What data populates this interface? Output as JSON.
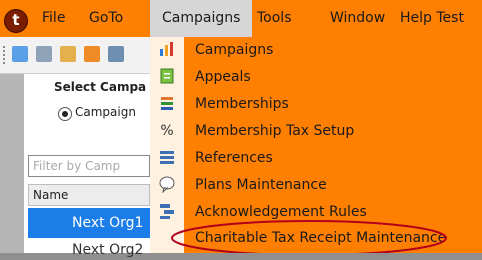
{
  "menubar": {
    "logo_letter": "t",
    "items": [
      {
        "label": "File"
      },
      {
        "label": "GoTo"
      },
      {
        "label": "Campaigns",
        "active": true
      },
      {
        "label": "Tools"
      },
      {
        "label": "Window"
      },
      {
        "label": "Help Test"
      }
    ]
  },
  "toolbar": {
    "icons": [
      "user-icon",
      "document-icon",
      "link-icon",
      "edit-icon",
      "form-icon"
    ]
  },
  "panel": {
    "title": "Select Campa",
    "radio_label": "Campaign",
    "filter_placeholder": "Filter by Camp",
    "column_header": "Name",
    "rows": [
      "Next Org1",
      "Next Org2"
    ]
  },
  "dropdown": {
    "items": [
      {
        "label": "Campaigns",
        "icon": "bar-chart-icon"
      },
      {
        "label": "Appeals",
        "icon": "green-document-icon"
      },
      {
        "label": "Memberships",
        "icon": "stack-icon"
      },
      {
        "label": "Membership Tax Setup",
        "icon": "percent-icon"
      },
      {
        "label": "References",
        "icon": "list-icon"
      },
      {
        "label": "Plans Maintenance",
        "icon": "speech-bubble-icon"
      },
      {
        "label": "Acknowledgement Rules",
        "icon": "stack-icon"
      },
      {
        "label": "Charitable Tax Receipt Maintenance",
        "icon": "none",
        "circled": true
      }
    ]
  },
  "colors": {
    "menu_orange": "#ff7f00",
    "selection_blue": "#1a7de8",
    "annotation_red": "#b3001b"
  }
}
